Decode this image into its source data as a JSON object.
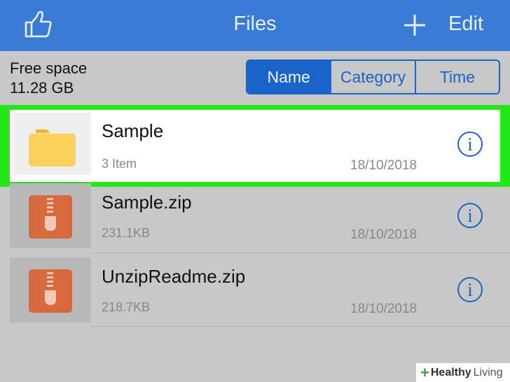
{
  "navbar": {
    "title": "Files",
    "like_icon": "thumbs-up-icon",
    "add_icon": "plus-icon",
    "edit_label": "Edit",
    "color": "#3a7bd5"
  },
  "storage": {
    "label": "Free space",
    "value": "11.28 GB"
  },
  "sort": {
    "options": [
      "Name",
      "Category",
      "Time"
    ],
    "selected": "Name",
    "accent": "#1a63c9"
  },
  "files": [
    {
      "name": "Sample",
      "meta": "3 Item",
      "date": "18/10/2018",
      "type": "folder",
      "icon": "folder-icon",
      "highlighted": true
    },
    {
      "name": "Sample.zip",
      "meta": "231.1KB",
      "date": "18/10/2018",
      "type": "zip",
      "icon": "zip-archive-icon"
    },
    {
      "name": "UnzipReadme.zip",
      "meta": "218.7KB",
      "date": "18/10/2018",
      "type": "zip",
      "icon": "zip-archive-icon"
    }
  ],
  "info_icon": "info-icon",
  "highlight_color": "#23e61b",
  "watermark": {
    "plus": "+",
    "brand": "Healthy",
    "brand2": "Living"
  }
}
